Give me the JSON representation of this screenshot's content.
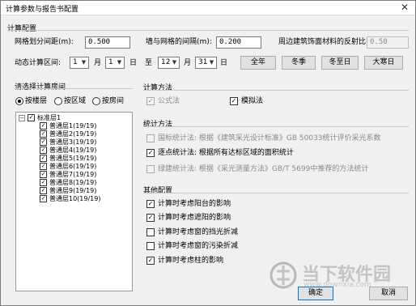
{
  "window": {
    "title": "计算参数与报告书配置",
    "close_glyph": "✕"
  },
  "calc_config": {
    "section_label": "计算配置",
    "grid_spacing_label": "网格划分间距(m):",
    "grid_spacing_value": "0.500",
    "wall_gap_label": "墙与网格的间隔(m):",
    "wall_gap_value": "0.200",
    "reflectance_label": "周边建筑饰面材料的反射比:",
    "reflectance_value": "0.50",
    "dynamic_label": "动态计算区间:",
    "start_month": "1",
    "month_label_1": "月",
    "start_day": "1",
    "day_label_1": "日",
    "to_label": "至",
    "end_month": "12",
    "month_label_2": "月",
    "end_day": "31",
    "day_label_2": "日",
    "btn_full_year": "全年",
    "btn_winter": "冬季",
    "btn_winter_solstice": "冬至日",
    "btn_major_cold": "大寒日"
  },
  "room_select": {
    "section_label": "请选择计算房间",
    "radio_by_floor": "按楼层",
    "radio_by_zone": "按区域",
    "radio_by_room": "按房间",
    "tree": {
      "root_label": "标准层1",
      "expander": "−",
      "items": [
        "普通层1(19/19)",
        "普通层2(19/19)",
        "普通层3(19/19)",
        "普通层4(19/19)",
        "普通层5(19/19)",
        "普通层6(19/19)",
        "普通层7(19/19)",
        "普通层8(19/19)",
        "普通层9(19/19)",
        "普通层10(19/19)"
      ]
    }
  },
  "calc_method": {
    "section_label": "计算方法",
    "formula_label": "公式法",
    "simulation_label": "模拟法"
  },
  "stat_method": {
    "section_label": "统计方法",
    "national_label": "国标统计法: 根据《建筑采光设计标准》GB 50033统计评价采光系数",
    "point_label": "逐点统计法: 根据所有达标区域的面积统计",
    "green_label": "绿建统计法: 根据《采光测量方法》GB/T 5699中推荐的方法统计"
  },
  "other_config": {
    "section_label": "其他配置",
    "opt_balcony": "计算时考虑阳台的影响",
    "opt_sunshade": "计算时考虑遮阳的影响",
    "opt_window_block": "计算时考虑窗的挡光折减",
    "opt_window_dirt": "计算时考虑窗的污染折减",
    "opt_column": "计算时考虑柱的影响"
  },
  "footer": {
    "ok_label": "确定",
    "cancel_label": "取消"
  },
  "watermark": {
    "brand_cn": "当下软件园",
    "brand_url": "www.downxia.com"
  },
  "glyphs": {
    "check": "✓",
    "dropdown": "▼"
  }
}
